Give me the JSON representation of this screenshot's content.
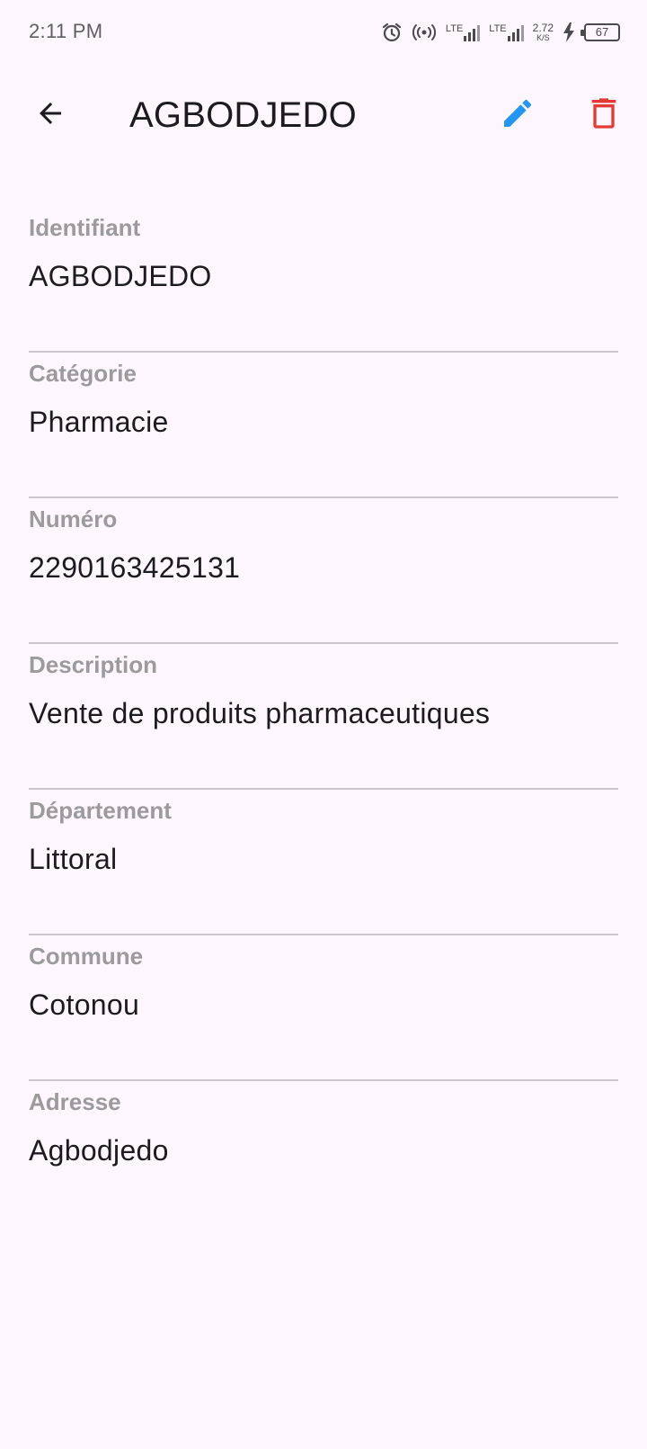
{
  "status_bar": {
    "time": "2:11 PM",
    "network_1": "LTE",
    "network_2": "LTE",
    "speed_value": "2.72",
    "speed_unit": "K/S",
    "battery_level": "67"
  },
  "app_bar": {
    "title": "AGBODJEDO",
    "icons": {
      "back": "arrow-back-icon",
      "edit": "pencil-icon",
      "delete": "trash-icon"
    },
    "colors": {
      "edit": "#2196f3",
      "delete": "#e53935"
    }
  },
  "fields": [
    {
      "label": "Identifiant",
      "value": "AGBODJEDO"
    },
    {
      "label": "Catégorie",
      "value": "Pharmacie"
    },
    {
      "label": "Numéro",
      "value": "2290163425131"
    },
    {
      "label": "Description",
      "value": "Vente de produits pharmaceutiques"
    },
    {
      "label": "Département",
      "value": "Littoral"
    },
    {
      "label": "Commune",
      "value": "Cotonou"
    },
    {
      "label": "Adresse",
      "value": "Agbodjedo"
    }
  ]
}
